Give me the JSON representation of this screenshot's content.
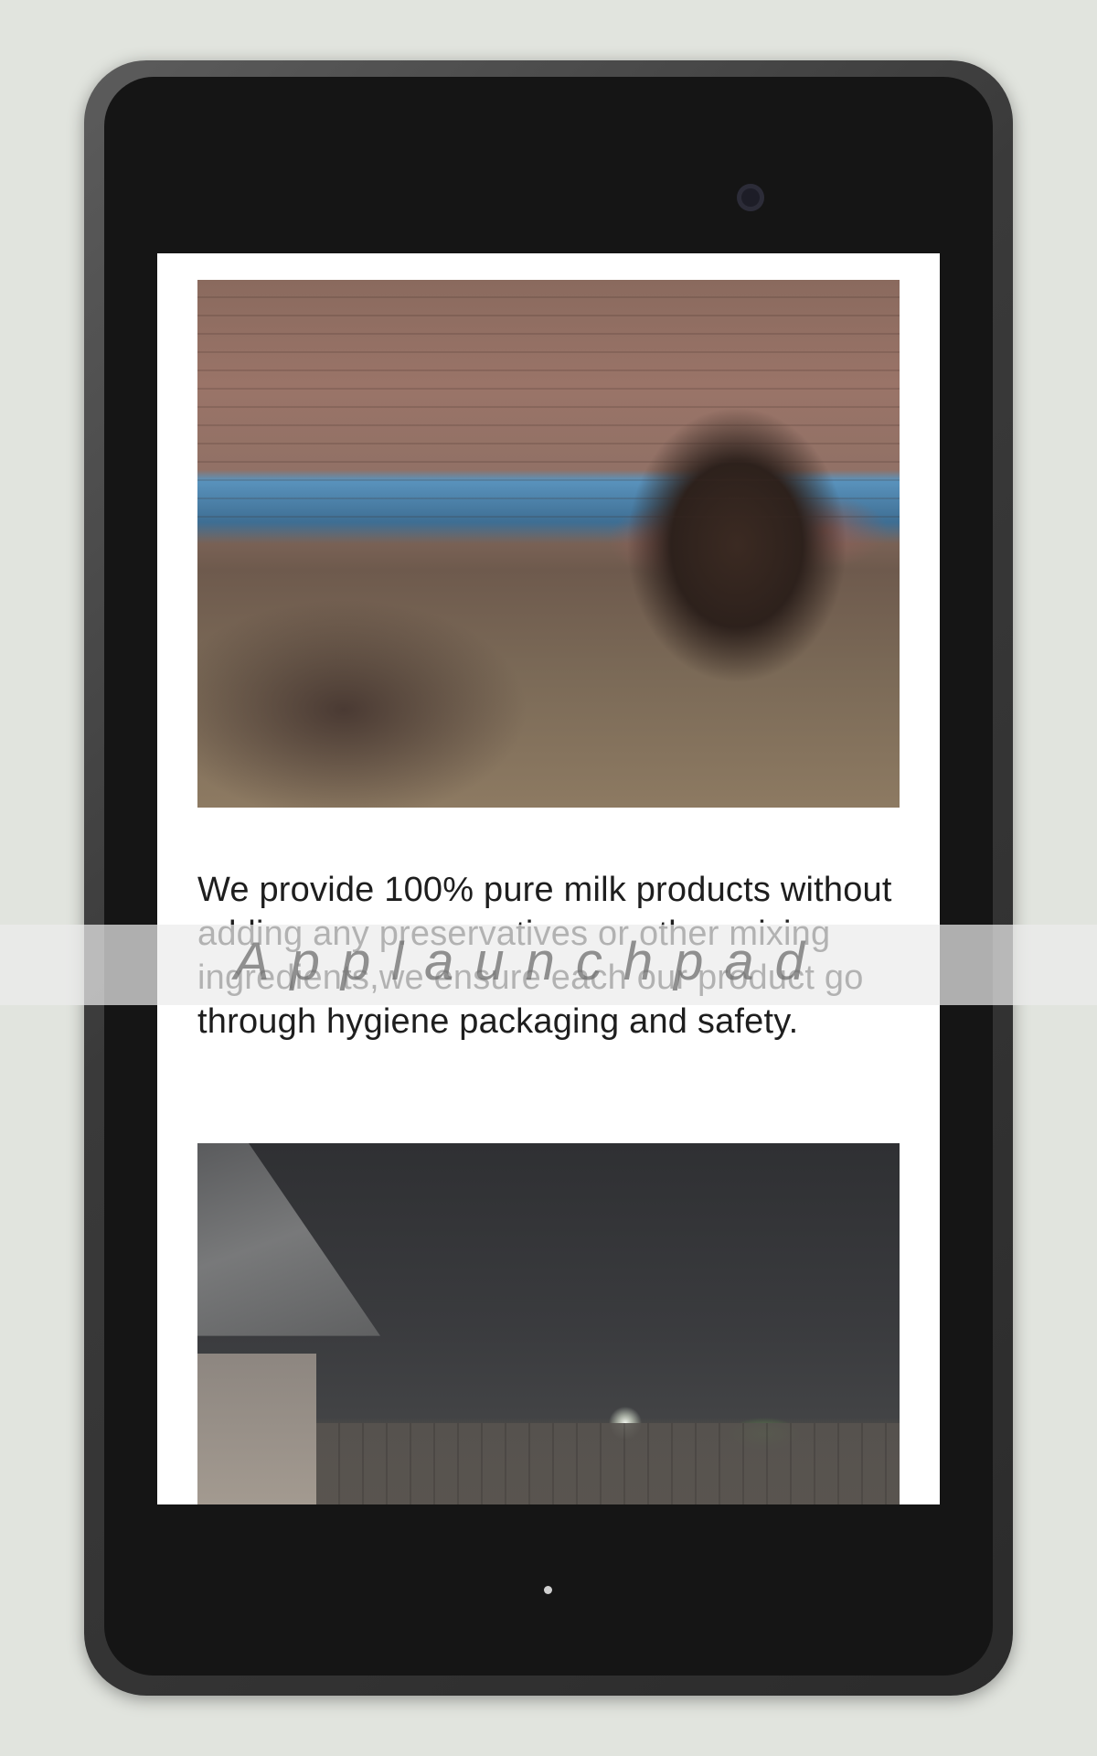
{
  "content": {
    "description": "We provide 100% pure milk products without adding any preservatives or other mixing ingredients,we ensure each our product go through hygiene packaging and safety."
  },
  "watermark": {
    "text": "Applaunchpad"
  },
  "device": {
    "frame_color": "#3a3a3a",
    "screen_background": "#ffffff",
    "page_background": "#e1e4de"
  },
  "icons": {
    "camera": "front-camera-icon",
    "home": "home-indicator-icon"
  }
}
